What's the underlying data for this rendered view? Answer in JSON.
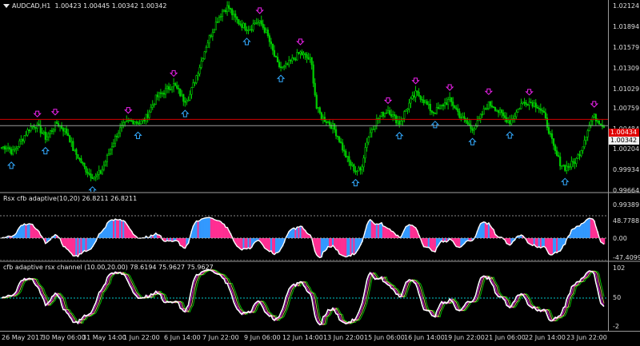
{
  "symbol_header": {
    "symbol": "AUDCAD,H1",
    "values": "1.00423 1.00445 1.00342 1.00342"
  },
  "price_scale": [
    "1.02124",
    "1.01894",
    "1.01579",
    "1.01309",
    "1.01029",
    "1.00759",
    "1.00484",
    "1.00204",
    "0.99934",
    "0.99664",
    "0.99389"
  ],
  "price_tags": {
    "red": "1.00434",
    "current": "1.00342"
  },
  "rsx_panel": {
    "title": "Rsx cfb adaptive(10,20) 26.8211 26.8211",
    "scale": [
      "48.7788",
      "0.00",
      "-47.4099"
    ]
  },
  "channel_panel": {
    "title": "cfb adaptive rsx channel (10.00,20.00) 78.6194 75.9627 75.9627",
    "scale": [
      "102",
      "50",
      "-2"
    ]
  },
  "time_axis": [
    "26 May 2017",
    "30 May 06:00",
    "31 May 14:00",
    "1 Jun 22:00",
    "6 Jun 14:00",
    "7 Jun 22:00",
    "9 Jun 06:00",
    "12 Jun 14:00",
    "13 Jun 22:00",
    "15 Jun 06:00",
    "16 Jun 14:00",
    "19 Jun 22:00",
    "21 Jun 06:00",
    "22 Jun 14:00",
    "23 Jun 22:00"
  ],
  "chart_data": {
    "type": "candlestick",
    "price_levels": {
      "red_line": 1.00434,
      "current_price": 1.00342
    },
    "close_path": [
      1.0002,
      1.0004,
      0.9994,
      1.0006,
      1.0018,
      1.003,
      1.0036,
      1.0028,
      1.0016,
      1.0027,
      1.0038,
      1.0031,
      1.0022,
      0.9998,
      0.9986,
      0.9972,
      0.9962,
      0.9958,
      0.9966,
      0.9985,
      1.0006,
      1.0024,
      1.0034,
      1.004,
      1.0042,
      1.0038,
      1.0044,
      1.006,
      1.0076,
      1.0082,
      1.0088,
      1.0096,
      1.0085,
      1.0072,
      1.0078,
      1.0102,
      1.0126,
      1.0152,
      1.0172,
      1.019,
      1.0204,
      1.021,
      1.0195,
      1.0186,
      1.018,
      1.0178,
      1.0188,
      1.0184,
      1.017,
      1.0145,
      1.0123,
      1.0118,
      1.0126,
      1.0134,
      1.0142,
      1.0136,
      1.013,
      1.006,
      1.0046,
      1.004,
      1.0032,
      1.0016,
      0.9994,
      0.9978,
      0.9968,
      0.9968,
      1.001,
      1.003,
      1.0044,
      1.0052,
      1.0058,
      1.0046,
      1.0038,
      1.0055,
      1.007,
      1.0082,
      1.0076,
      1.0064,
      1.0054,
      1.0058,
      1.0066,
      1.0072,
      1.0062,
      1.0048,
      1.004,
      1.003,
      1.0036,
      1.0052,
      1.0066,
      1.0064,
      1.0054,
      1.0046,
      1.004,
      1.0052,
      1.0066,
      1.007,
      1.0068,
      1.0064,
      1.0052,
      1.0028,
      0.9998,
      0.998,
      0.9972,
      0.9976,
      0.9984,
      1.0002,
      1.0028,
      1.0048,
      1.0042,
      1.0034
    ]
  }
}
